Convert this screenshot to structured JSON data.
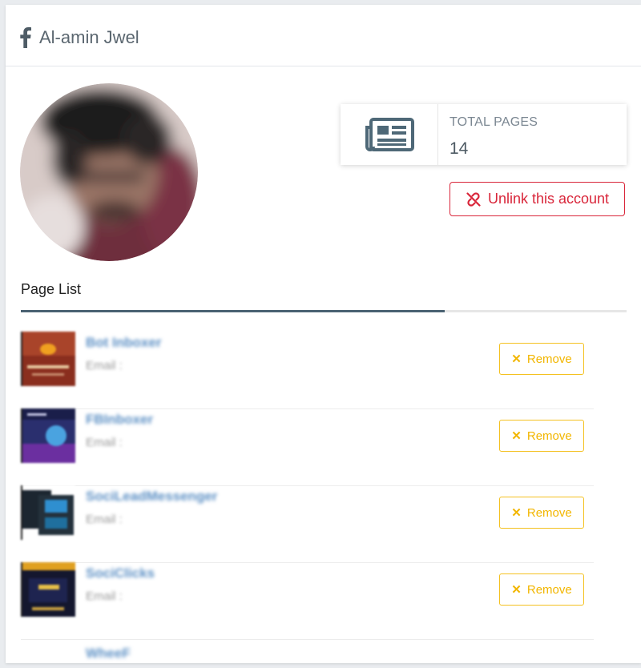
{
  "header": {
    "icon": "facebook-icon",
    "title": "Al-amin Jwel"
  },
  "profile": {
    "avatar": "avatar"
  },
  "stats": {
    "icon": "newspaper-icon",
    "label": "TOTAL PAGES",
    "value": "14"
  },
  "unlink": {
    "icon": "unlink-icon",
    "label": "Unlink this account",
    "color": "#d9263a"
  },
  "page_list": {
    "title": "Page List",
    "remove_label": "Remove",
    "remove_color": "#f2b600",
    "items": [
      {
        "name": "Bot Inboxer",
        "email": "Email :"
      },
      {
        "name": "FBInboxer",
        "email": "Email :"
      },
      {
        "name": "SociLeadMessenger",
        "email": "Email :"
      },
      {
        "name": "SociClicks",
        "email": "Email :"
      }
    ],
    "partial_item": "WheeF"
  }
}
